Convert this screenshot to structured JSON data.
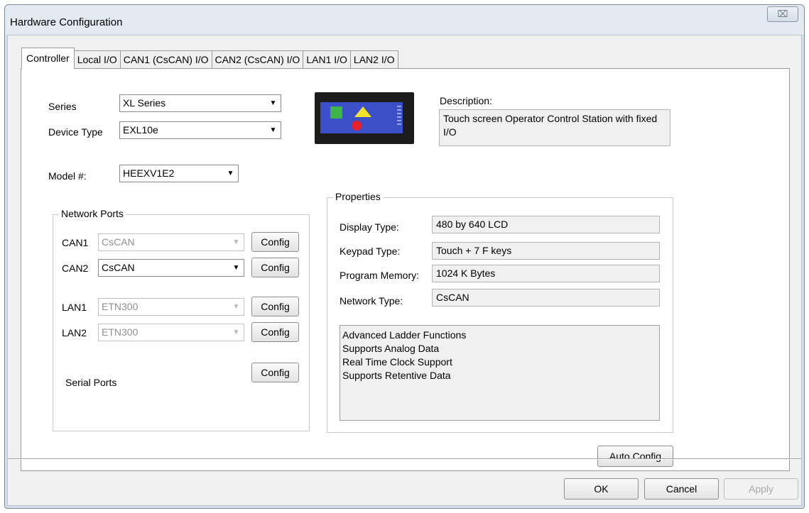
{
  "window": {
    "title": "Hardware Configuration",
    "close_glyph": "⌧"
  },
  "tabs": [
    {
      "label": "Controller",
      "active": true
    },
    {
      "label": "Local I/O",
      "active": false
    },
    {
      "label": "CAN1 (CsCAN) I/O",
      "active": false
    },
    {
      "label": "CAN2 (CsCAN) I/O",
      "active": false
    },
    {
      "label": "LAN1 I/O",
      "active": false
    },
    {
      "label": "LAN2 I/O",
      "active": false
    }
  ],
  "controller": {
    "series_label": "Series",
    "series_value": "XL Series",
    "device_type_label": "Device Type",
    "device_type_value": "EXL10e",
    "model_label": "Model #:",
    "model_value": "HEEXV1E2",
    "description_label": "Description:",
    "description_value": "Touch screen Operator Control Station with fixed I/O"
  },
  "network_ports": {
    "legend": "Network Ports",
    "ports": [
      {
        "label": "CAN1",
        "value": "CsCAN",
        "enabled": false
      },
      {
        "label": "CAN2",
        "value": "CsCAN",
        "enabled": true
      },
      {
        "label": "LAN1",
        "value": "ETN300",
        "enabled": false
      },
      {
        "label": "LAN2",
        "value": "ETN300",
        "enabled": false
      }
    ],
    "serial_label": "Serial Ports",
    "config_label": "Config"
  },
  "properties": {
    "legend": "Properties",
    "display_type_label": "Display Type:",
    "display_type_value": "480 by 640 LCD",
    "keypad_type_label": "Keypad Type:",
    "keypad_type_value": "Touch + 7 F keys",
    "program_memory_label": "Program Memory:",
    "program_memory_value": "1024 K Bytes",
    "network_type_label": "Network Type:",
    "network_type_value": "CsCAN",
    "features": [
      "Advanced Ladder Functions",
      "Supports Analog Data",
      "Real Time Clock Support",
      "Supports Retentive Data"
    ]
  },
  "buttons": {
    "auto_config": "Auto Config",
    "ok": "OK",
    "cancel": "Cancel",
    "apply": "Apply"
  },
  "icons": {
    "dropdown": "▼",
    "device": "operator-panel-device-icon"
  },
  "colors": {
    "device_bezel": "#1b1b1b",
    "device_screen": "#3a4fc8",
    "device_square": "#3cb44a",
    "device_triangle": "#f2e22a",
    "device_dot": "#e8202a"
  }
}
